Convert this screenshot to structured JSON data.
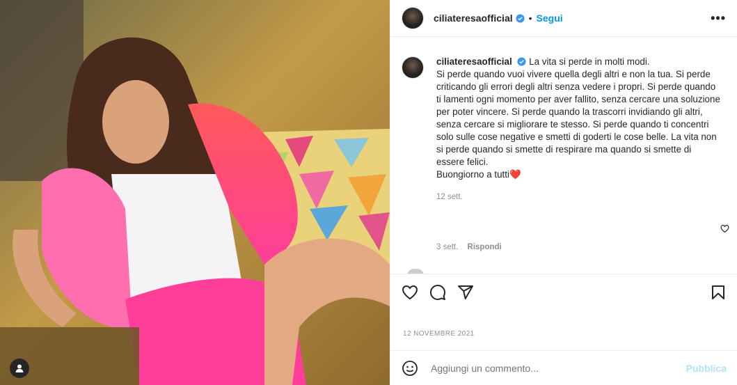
{
  "post": {
    "username": "ciliateresaofficial",
    "follow_label": "Segui",
    "separator": "•",
    "more_label": "•••"
  },
  "caption": {
    "username": "ciliateresaofficial",
    "text_first": "La vita si perde in molti modi.",
    "text_body": "Si perde quando vuoi vivere quella degli altri e non la tua. Si perde criticando gli errori degli altri senza vedere i propri. Si perde quando ti lamenti ogni momento per aver fallito, senza cercare una soluzione per poter vincere. Si perde quando la trascorri invidiando gli altri, senza cercare si migliorare te stesso. Si perde quando ti concentri solo sulle cose negative e smetti di goderti le cose belle. La vita non si perde quando si smette di respirare ma quando si smette di essere felici.",
    "text_last": "Buongiorno a tutti",
    "emoji": "❤️",
    "time": "12 sett."
  },
  "reply": {
    "time": "3 sett.",
    "reply_label": "Rispondi"
  },
  "date": "12 NOVEMBRE 2021",
  "add_comment": {
    "placeholder": "Aggiungi un commento...",
    "publish_label": "Pubblica"
  },
  "colors": {
    "accent": "#0095f6",
    "publish_disabled": "#b2dffc",
    "muted": "#8e8e8e"
  },
  "icons": [
    "verified-badge-icon",
    "more-options-icon",
    "like-icon",
    "comment-icon",
    "share-icon",
    "save-icon",
    "emoji-icon",
    "small-like-icon",
    "user-tag-icon"
  ]
}
